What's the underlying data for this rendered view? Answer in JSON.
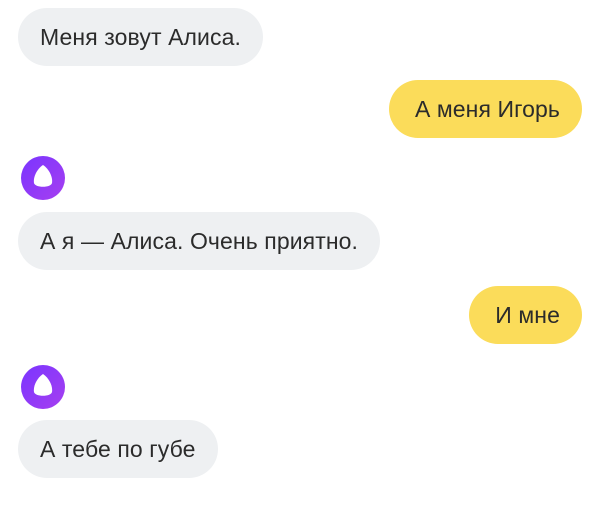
{
  "messages": [
    {
      "sender": "assistant",
      "text": "Меня зовут Алиса."
    },
    {
      "sender": "user",
      "text": "А меня Игорь"
    },
    {
      "sender": "assistant",
      "text": "А я — Алиса. Очень приятно."
    },
    {
      "sender": "user",
      "text": "И мне"
    },
    {
      "sender": "assistant",
      "text": "А тебе по губе"
    }
  ],
  "colors": {
    "assistant_bubble": "#eef0f2",
    "user_bubble": "#fbdc5a",
    "avatar_gradient_start": "#7a35ff",
    "avatar_gradient_end": "#a03cf0",
    "text": "#2b2b2b"
  },
  "icons": {
    "assistant_avatar": "alice-logo-icon"
  }
}
